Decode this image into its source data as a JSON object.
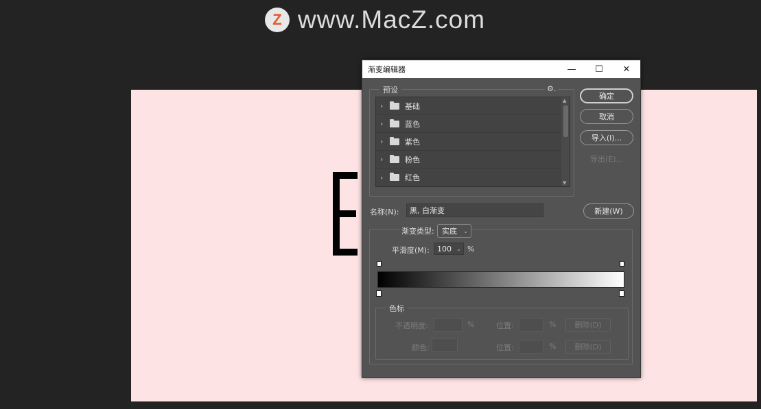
{
  "watermark": {
    "logo_letter": "Z",
    "text": "www.MacZ.com"
  },
  "dialog": {
    "title": "渐变编辑器",
    "window_buttons": {
      "minimize": "—",
      "maximize": "☐",
      "close": "✕"
    },
    "presets": {
      "label": "预设",
      "gear": "⚙.",
      "items": [
        {
          "label": "基础"
        },
        {
          "label": "蓝色"
        },
        {
          "label": "紫色"
        },
        {
          "label": "粉色"
        },
        {
          "label": "红色"
        }
      ]
    },
    "buttons": {
      "ok": "确定",
      "cancel": "取消",
      "import": "导入(I)...",
      "export": "导出(E)...",
      "new": "新建(W)"
    },
    "name": {
      "label": "名称(N):",
      "value": "黑, 白渐变"
    },
    "gradient_type": {
      "label": "渐变类型:",
      "value": "实底"
    },
    "smoothness": {
      "label": "平滑度(M):",
      "value": "100",
      "unit": "%"
    },
    "color_stops": {
      "label": "色标",
      "opacity_label": "不透明度:",
      "opacity_unit": "%",
      "position_label": "位置:",
      "position_unit": "%",
      "delete_label": "删除(D)",
      "color_label": "颜色:"
    },
    "gradient_colors": {
      "start": "#000000",
      "end": "#ffffff"
    }
  },
  "colors": {
    "canvas": "#fde3e4",
    "workspace": "#232323",
    "panel": "#535353"
  }
}
